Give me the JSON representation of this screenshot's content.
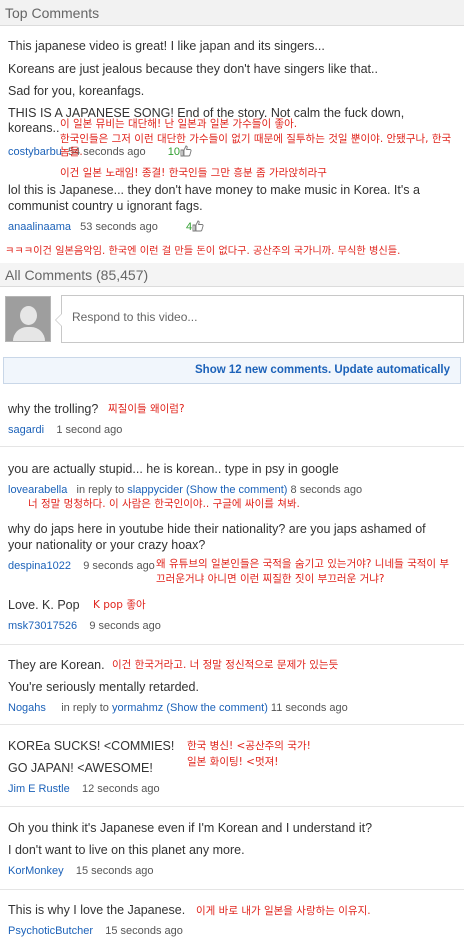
{
  "top_comments": {
    "header": "Top Comments",
    "items": [
      {
        "lines": [
          "This japanese video is great! I like japan and its singers...",
          "Koreans are just jealous because they don't have singers like that..",
          "Sad for you, koreanfags.",
          "THIS IS A JAPANESE SONG! End of the story. Not calm the fuck down, koreans.."
        ],
        "translation": [
          "이 일본 뮤비는 대단해! 난 일본과 일본 가수들이 좋아.",
          "한국인들은 그저 이런 대단한 가수들이 없기 때문에 질투하는 것일 뿐이야. 안됐구나, 한국놈들.",
          "이건 일본 노래임! 종결! 한국인들 그만 흥분 좀 가라앉히라구"
        ],
        "user": "costybarbu",
        "time": "54 seconds ago",
        "likes": "10"
      },
      {
        "lines": [
          "lol this is Japanese... they don't have money to make music in Korea. It's a communist country u ignorant fags."
        ],
        "translation": "ㅋㅋㅋ이건 일본음악임. 한국엔 이런 걸 만들 돈이 없다구. 공산주의 국가니까. 무식한 병신들.",
        "user": "anaalinaama",
        "time": "53 seconds ago",
        "likes": "4"
      }
    ]
  },
  "all_comments": {
    "header": "All Comments (85,457)",
    "respond_placeholder": "Respond to this video...",
    "show_new": "Show 12 new comments. Update automatically",
    "items": [
      {
        "text": "why the trolling?",
        "translation": "찌질이들 왜이럼?",
        "user": "sagardi",
        "time": "1 second ago"
      },
      {
        "text": "you are actually stupid... he is korean.. type in psy in google",
        "translation": "너 정말 멍청하다. 이 사람은 한국인이야.. 구글에 싸이를 쳐봐.",
        "user": "lovearabella",
        "reply_prefix": "in reply to",
        "reply_to": "slappycider",
        "show_comment": "(Show the comment)",
        "time": "8 seconds ago"
      },
      {
        "text": "why do japs here in youtube hide their nationality? are you japs ashamed of your nationality or your crazy hoax?",
        "translation": "왜 유튜브의 일본인들은 국적을 숨기고 있는거야? 니네들 국적이 부끄러운거냐 아니면 이런 찌질한 짓이 부끄러운 거냐?",
        "user": "despina1022",
        "time": "9 seconds ago"
      },
      {
        "text": "Love. K. Pop",
        "translation": "K pop 좋아",
        "user": "msk73017526",
        "time": "9 seconds ago"
      },
      {
        "lines": [
          "They are Korean.",
          "You're seriously mentally retarded."
        ],
        "translation": "이건 한국거라고. 너 정말 정신적으로 문제가 있는듯",
        "user": "Nogahs",
        "reply_prefix": "in reply to",
        "reply_to": "yormahmz",
        "show_comment": "(Show the comment)",
        "time": "11 seconds ago"
      },
      {
        "lines": [
          "KOREa SUCKS! <COMMIES!",
          "GO JAPAN! <AWESOME!"
        ],
        "translation": [
          "한국 병신! <공산주의 국가!",
          "일본 화이팅! <멋져!"
        ],
        "user": "Jim E Rustle",
        "time": "12 seconds ago"
      },
      {
        "lines": [
          "Oh you think it's Japanese even if I'm Korean and I understand it?",
          "I don't want to live on this planet any more."
        ],
        "user": "KorMonkey",
        "time": "15 seconds ago"
      },
      {
        "text": "This is why I love the Japanese.",
        "translation": "이게 바로 내가 일본을 사랑하는 이유지.",
        "user": "PsychoticButcher",
        "time": "15 seconds ago"
      }
    ]
  },
  "colors": {
    "username": "#1c62b9",
    "translation": "#e0241c",
    "likes": "#2f9e2f",
    "header_bg": "#f2f2f2"
  },
  "icons": {
    "likes": "thumbs-up-icon",
    "avatar": "default-avatar-icon"
  }
}
